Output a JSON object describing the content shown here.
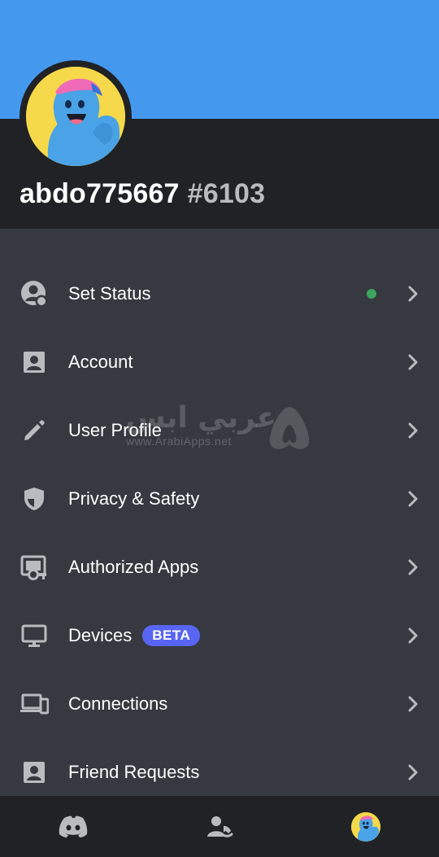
{
  "profile": {
    "username": "abdo775667",
    "tag": "#6103",
    "avatar": "blue-cartoon-avatar"
  },
  "colors": {
    "banner": "#4499ee",
    "header_bg": "#202225",
    "list_bg": "#36393f",
    "status_online": "#3ba55d",
    "beta_badge": "#5865f2"
  },
  "menu": [
    {
      "label": "Set Status",
      "icon": "status-icon",
      "status": "online"
    },
    {
      "label": "Account",
      "icon": "account-icon"
    },
    {
      "label": "User Profile",
      "icon": "pencil-icon"
    },
    {
      "label": "Privacy & Safety",
      "icon": "shield-icon"
    },
    {
      "label": "Authorized Apps",
      "icon": "authorized-apps-icon"
    },
    {
      "label": "Devices",
      "icon": "monitor-icon",
      "badge": "BETA"
    },
    {
      "label": "Connections",
      "icon": "connections-icon"
    },
    {
      "label": "Friend Requests",
      "icon": "friend-requests-icon"
    }
  ],
  "watermark": {
    "arabic": "عربي ابس",
    "url": "www.ArabiApps.net"
  },
  "bottom_nav": [
    {
      "name": "home",
      "icon": "discord-logo-icon"
    },
    {
      "name": "friends",
      "icon": "friends-icon"
    },
    {
      "name": "profile",
      "icon": "profile-avatar-icon"
    }
  ]
}
